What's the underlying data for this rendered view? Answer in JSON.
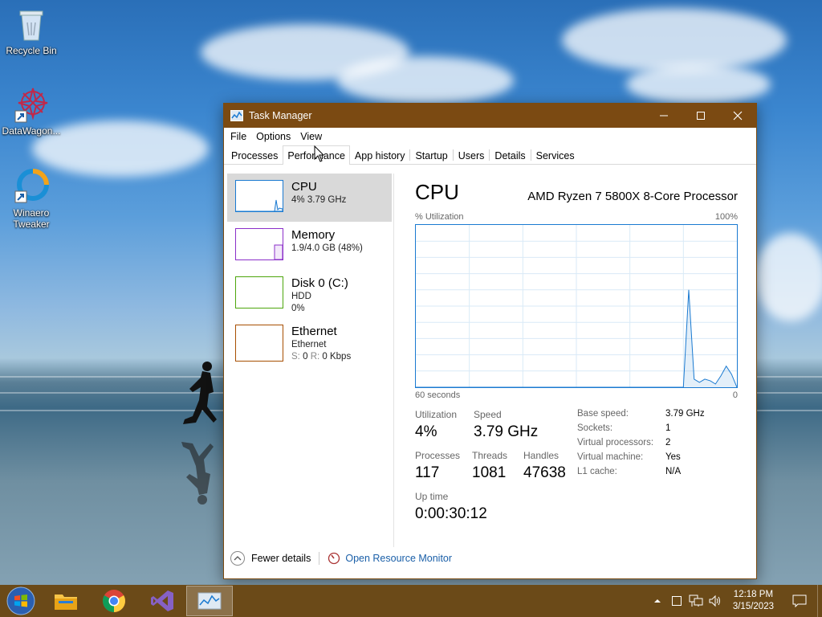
{
  "desktop": {
    "icons": [
      {
        "label": "Recycle Bin"
      },
      {
        "label": "DataWagon..."
      },
      {
        "label": "Winaero Tweaker"
      }
    ]
  },
  "window": {
    "title": "Task Manager",
    "menu": [
      "File",
      "Options",
      "View"
    ],
    "tabs": [
      "Processes",
      "Performance",
      "App history",
      "Startup",
      "Users",
      "Details",
      "Services"
    ],
    "active_tab": "Performance"
  },
  "sidebar": {
    "items": [
      {
        "title": "CPU",
        "line1": "4%  3.79 GHz",
        "color": "#1a7ad1"
      },
      {
        "title": "Memory",
        "line1": "1.9/4.0 GB (48%)",
        "color": "#8b2fc9"
      },
      {
        "title": "Disk 0 (C:)",
        "line1": "HDD",
        "line2": "0%",
        "color": "#4da60c"
      },
      {
        "title": "Ethernet",
        "line1": "Ethernet",
        "line2_s": "S:",
        "line2_s_val": "0",
        "line2_r": "R:",
        "line2_r_val": "0 Kbps",
        "color": "#a74f01"
      }
    ]
  },
  "main": {
    "title": "CPU",
    "processor": "AMD Ryzen 7 5800X 8-Core Processor",
    "graph_label_left": "% Utilization",
    "graph_label_right": "100%",
    "graph_bottom_left": "60 seconds",
    "graph_bottom_right": "0",
    "stats": {
      "utilization_label": "Utilization",
      "utilization": "4%",
      "speed_label": "Speed",
      "speed": "3.79 GHz",
      "processes_label": "Processes",
      "processes": "117",
      "threads_label": "Threads",
      "threads": "1081",
      "handles_label": "Handles",
      "handles": "47638",
      "uptime_label": "Up time",
      "uptime": "0:00:30:12"
    },
    "specs": [
      {
        "k": "Base speed:",
        "v": "3.79 GHz"
      },
      {
        "k": "Sockets:",
        "v": "1"
      },
      {
        "k": "Virtual processors:",
        "v": "2"
      },
      {
        "k": "Virtual machine:",
        "v": "Yes"
      },
      {
        "k": "L1 cache:",
        "v": "N/A"
      }
    ]
  },
  "footer": {
    "fewer_details": "Fewer details",
    "resource_monitor": "Open Resource Monitor"
  },
  "taskbar": {
    "time": "12:18 PM",
    "date": "3/15/2023"
  },
  "chart_data": {
    "type": "area",
    "x": [
      60,
      10,
      9,
      8,
      7,
      6,
      5,
      4,
      3,
      2,
      1,
      0
    ],
    "values": [
      0,
      0,
      60,
      5,
      3,
      5,
      4,
      2,
      7,
      13,
      8,
      0
    ],
    "ylim": [
      0,
      100
    ],
    "color": "#1a7ad1"
  }
}
